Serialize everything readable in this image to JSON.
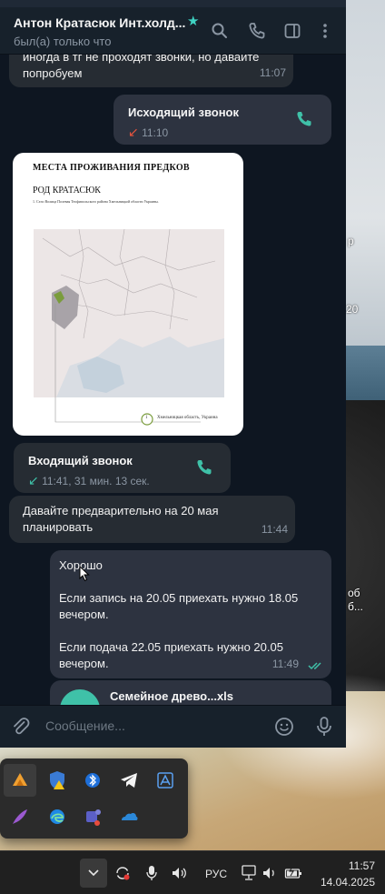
{
  "window": {
    "chat_title": "Антон Кратасюк Инт.холд...",
    "chat_status": "был(а) только что"
  },
  "messages": {
    "m1": {
      "text": "иногда в тг не проходят звонки, но давайте попробуем",
      "time": "11:07"
    },
    "m2": {
      "title": "Исходящий звонок",
      "sub": "11:10"
    },
    "m3": {
      "doc_title": "МЕСТА ПРОЖИВАНИЯ ПРЕДКОВ",
      "doc_sub": "РОД КРАТАСЮК",
      "doc_line": "1.    Село Волица Полевая Теофипольского района Хмельницкой области Украины.",
      "legend_num": "1",
      "legend_text": "Хмельницкая область, Украина"
    },
    "m4": {
      "title": "Входящий звонок",
      "sub": "11:41, 31 мин. 13 сек."
    },
    "m5": {
      "text": "Давайте предварительно на 20 мая планировать",
      "time": "11:44"
    },
    "m6": {
      "line1": "Хорошо",
      "line2": "Если запись на 20.05 приехать нужно 18.05 вечером.",
      "line3": "Если подача 22.05 приехать нужно 20.05 вечером.",
      "time": "11:49"
    },
    "m7": {
      "file_name": "Семейное древо...xls"
    }
  },
  "composer": {
    "placeholder": "Сообщение..."
  },
  "desktop": {
    "t1": "р",
    "t2": "20",
    "t3": "об",
    "t4": "б..."
  },
  "taskbar": {
    "lang": "РУС",
    "time": "11:57",
    "date": "14.04.2025"
  },
  "colors": {
    "accent": "#3fc1a8",
    "bg": "#0e1621",
    "header": "#17212b",
    "bubble_in": "#262c33",
    "bubble_out": "#2d3340",
    "missed": "#e5533d"
  },
  "icons": {
    "header": [
      "search-icon",
      "phone-icon",
      "sidebar-icon",
      "more-vertical-icon"
    ],
    "tray": [
      "aimp-icon",
      "defender-warning-icon",
      "bluetooth-icon",
      "telegram-icon",
      "image-viewer-icon",
      "feather-icon",
      "edge-icon",
      "teams-icon",
      "onedrive-icon"
    ]
  }
}
